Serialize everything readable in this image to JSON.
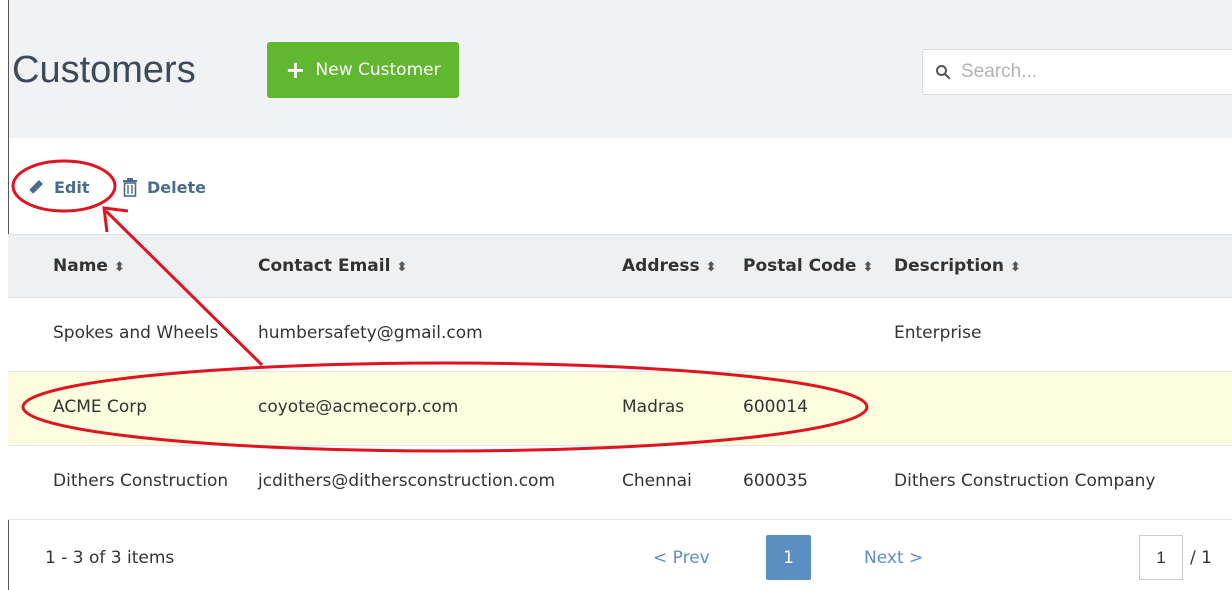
{
  "page": {
    "title": "Customers"
  },
  "header": {
    "new_button_label": "New Customer",
    "search_placeholder": "Search..."
  },
  "toolbar": {
    "edit_label": "Edit",
    "delete_label": "Delete"
  },
  "table": {
    "columns": [
      "Name",
      "Contact Email",
      "Address",
      "Postal Code",
      "Description"
    ],
    "rows": [
      {
        "name": "Spokes and Wheels",
        "email": "humbersafety@gmail.com",
        "address": "",
        "postal": "",
        "description": "Enterprise"
      },
      {
        "name": "ACME Corp",
        "email": "coyote@acmecorp.com",
        "address": "Madras",
        "postal": "600014",
        "description": ""
      },
      {
        "name": "Dithers Construction",
        "email": "jcdithers@dithersconstruction.com",
        "address": "Chennai",
        "postal": "600035",
        "description": "Dithers Construction Company"
      }
    ]
  },
  "pager": {
    "info": "1 - 3 of 3 items",
    "prev": "< Prev",
    "current": "1",
    "next": "Next >",
    "page_input": "1",
    "total": "/ 1"
  },
  "colors": {
    "accent_green": "#62b730",
    "link_blue": "#5b8fc1",
    "highlight_row": "#fdfde0",
    "annotation_red": "#e0141e"
  }
}
